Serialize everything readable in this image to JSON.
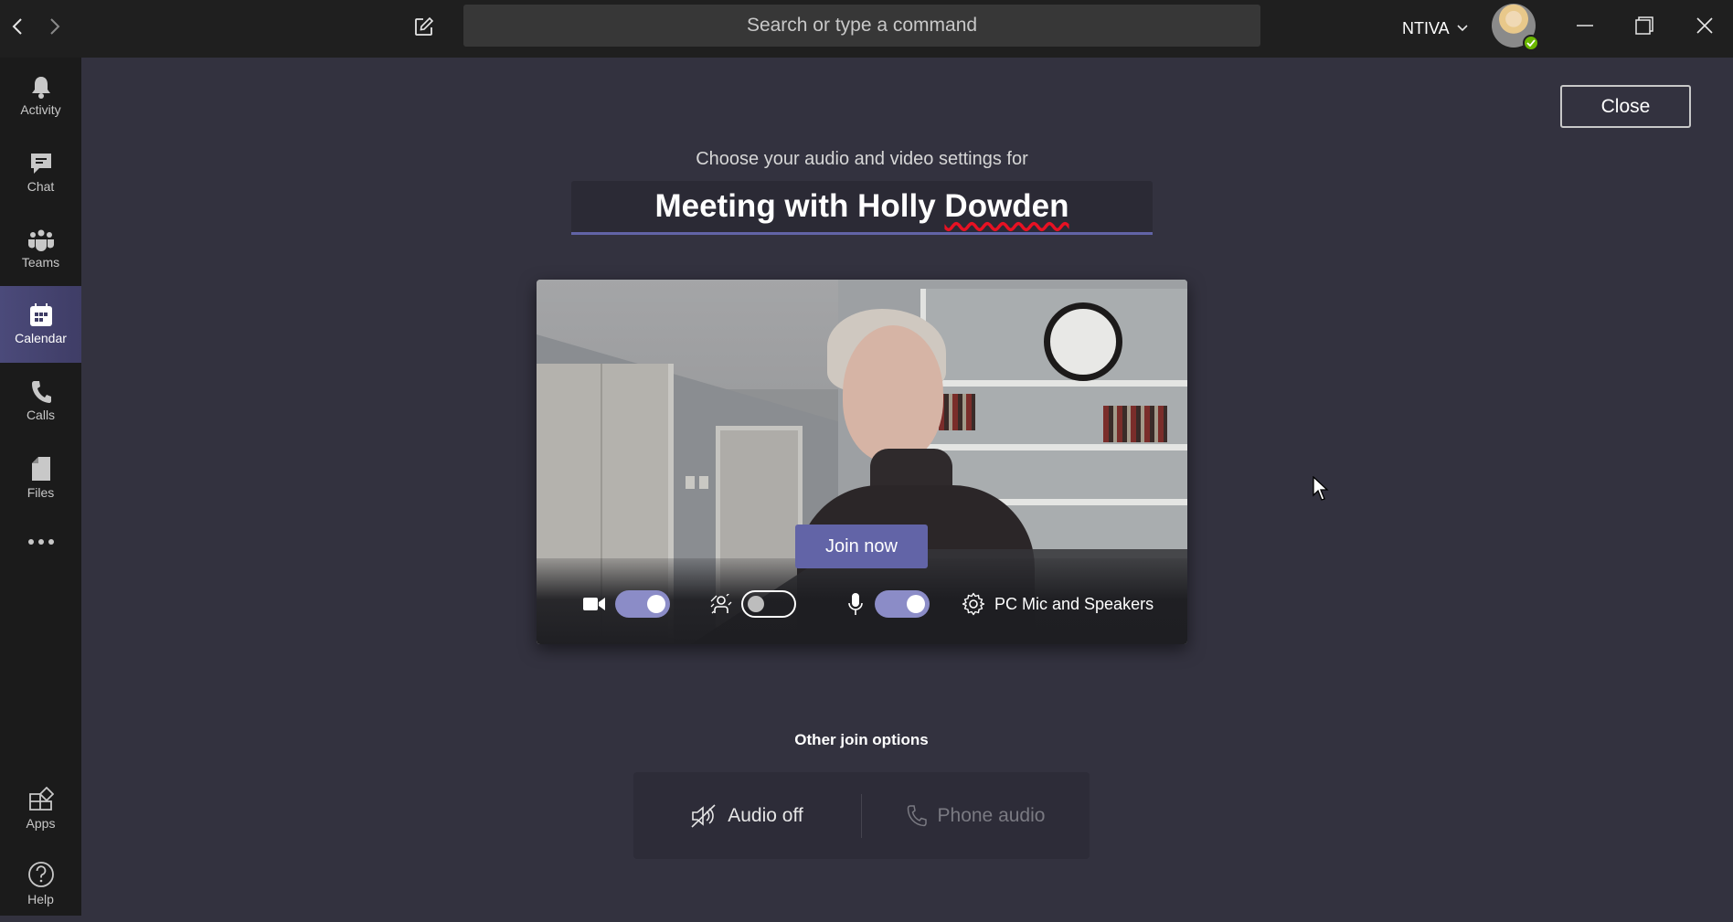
{
  "titlebar": {
    "search_placeholder": "Search or type a command",
    "org_name": "NTIVA",
    "presence_status": "available",
    "icons": {
      "back": "chevron-left-icon",
      "forward": "chevron-right-icon",
      "compose": "compose-icon",
      "org_dropdown": "chevron-down-icon",
      "minimize": "minimize-icon",
      "maximize": "restore-icon",
      "close": "close-icon"
    }
  },
  "sidebar": {
    "items": [
      {
        "label": "Activity",
        "icon": "bell-icon",
        "active": false
      },
      {
        "label": "Chat",
        "icon": "chat-icon",
        "active": false
      },
      {
        "label": "Teams",
        "icon": "teams-icon",
        "active": false
      },
      {
        "label": "Calendar",
        "icon": "calendar-icon",
        "active": true
      },
      {
        "label": "Calls",
        "icon": "phone-icon",
        "active": false
      },
      {
        "label": "Files",
        "icon": "file-icon",
        "active": false
      },
      {
        "label": "",
        "icon": "more-icon",
        "active": false
      }
    ],
    "bottom_items": [
      {
        "label": "Apps",
        "icon": "apps-icon"
      },
      {
        "label": "Help",
        "icon": "help-icon"
      }
    ]
  },
  "main": {
    "close_label": "Close",
    "subtitle": "Choose your audio and video settings for",
    "meeting_title_prefix": "Meeting with Holly ",
    "meeting_title_misspelled": "Dowden",
    "join_label": "Join now",
    "controls": {
      "camera_on": true,
      "background_blur_on": false,
      "microphone_on": true,
      "audio_device": "PC Mic and Speakers"
    },
    "other_join": {
      "title": "Other join options",
      "options": [
        {
          "label": "Audio off",
          "icon": "speaker-off-icon",
          "enabled": true
        },
        {
          "label": "Phone audio",
          "icon": "phone-icon",
          "enabled": false
        }
      ]
    }
  },
  "colors": {
    "accent": "#6264a7",
    "toggle_on": "#8b8cc7",
    "presence_available": "#6bb700",
    "titlebar_bg": "#1f1f1f",
    "sidebar_bg": "#1b1b1b",
    "main_bg": "#33323f"
  }
}
